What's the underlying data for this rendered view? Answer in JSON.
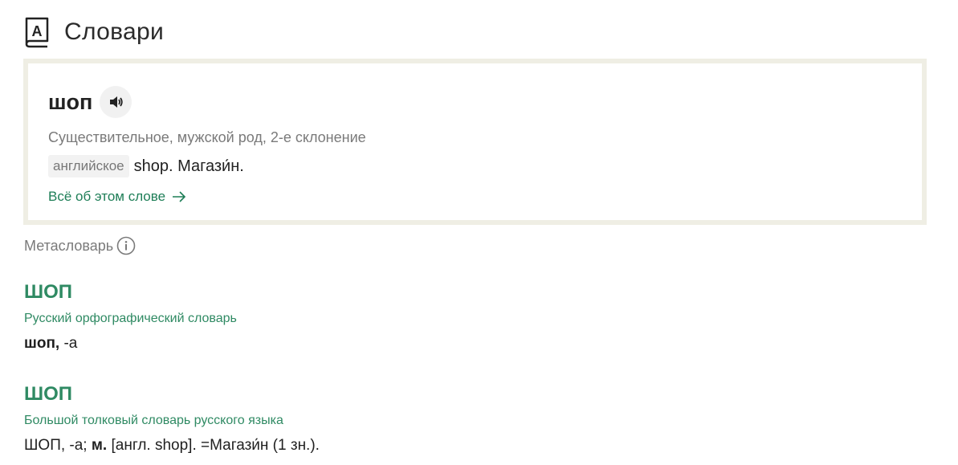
{
  "header": {
    "icon": "dictionary-book-icon",
    "icon_letter": "A",
    "title": "Словари"
  },
  "card": {
    "word": "шоп",
    "sound_icon": "speaker-icon",
    "part_of_speech": "Существительное, мужской род, 2-е склонение",
    "origin_tag": "английское",
    "origin_text": "shop. Магази́н.",
    "all_link": "Всё об этом слове",
    "arrow_icon": "arrow-right-icon"
  },
  "metadict": {
    "label": "Метасловарь",
    "icon": "info-icon"
  },
  "entries": [
    {
      "headword": "ШОП",
      "dictionary": "Русский орфографический словарь",
      "def_bold": "шоп,",
      "def_rest": " -а"
    },
    {
      "headword": "ШОП",
      "dictionary": "Большой толковый словарь русского языка",
      "def_start": "ШОП, -а; ",
      "def_bold": "м.",
      "def_rest": " [англ. shop]. =Магази́н (1 зн.)."
    }
  ],
  "colors": {
    "accent_green": "#2f8a63",
    "link_green": "#1e7e57",
    "card_border": "#efeee4"
  }
}
